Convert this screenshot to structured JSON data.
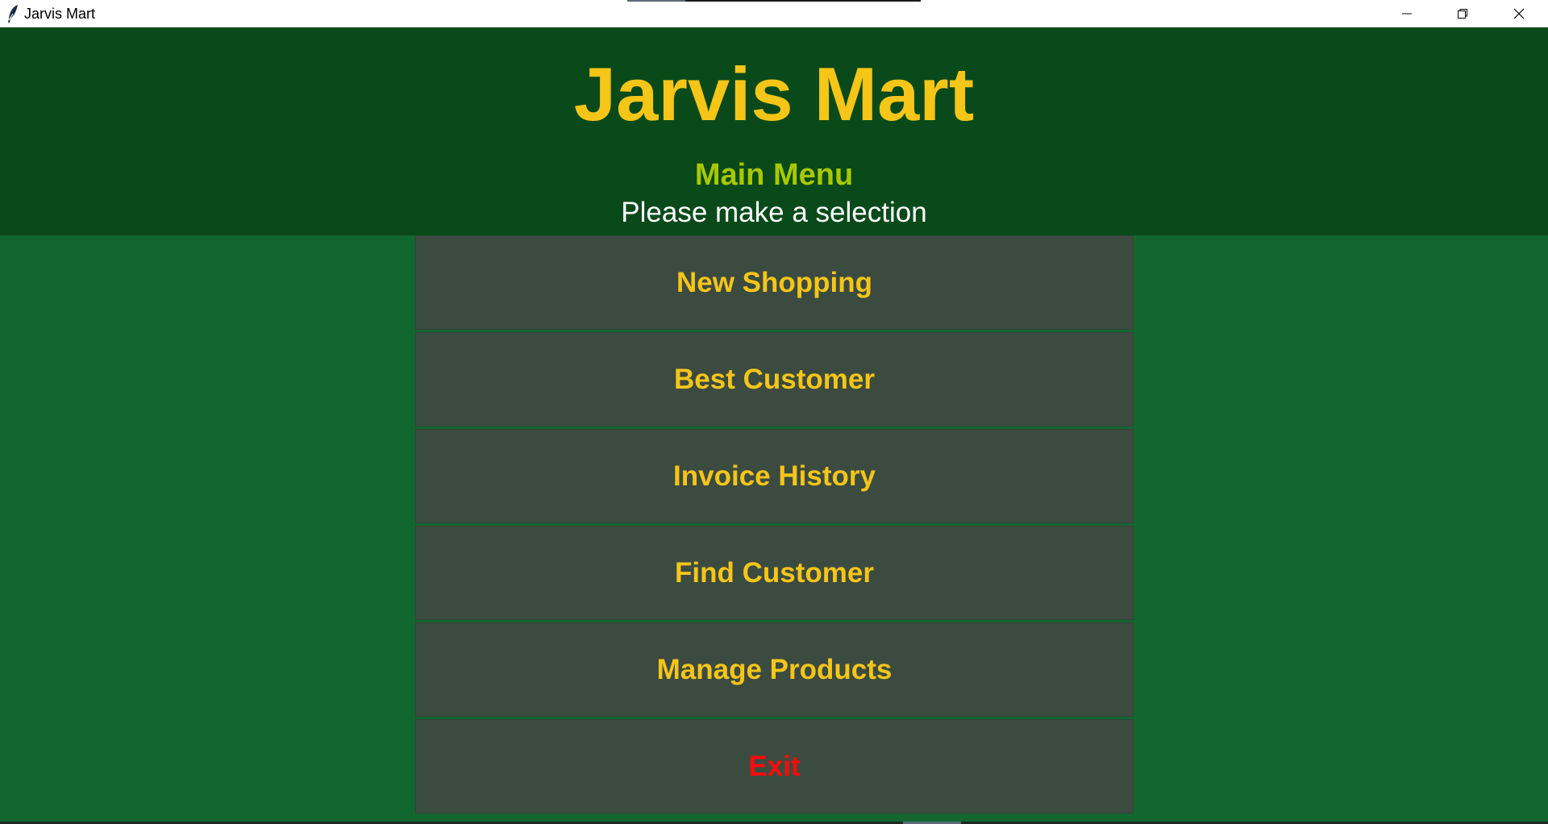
{
  "window": {
    "title": "Jarvis Mart"
  },
  "header": {
    "title": "Jarvis Mart",
    "subtitle": "Main Menu",
    "instruction": "Please make a selection"
  },
  "menu": {
    "items": [
      {
        "label": "New Shopping"
      },
      {
        "label": "Best Customer"
      },
      {
        "label": "Invoice History"
      },
      {
        "label": "Find Customer"
      },
      {
        "label": "Manage Products"
      },
      {
        "label": "Exit"
      }
    ]
  },
  "colors": {
    "header_bg": "#0a4a1a",
    "body_bg": "#126630",
    "title": "#f5c518",
    "subtitle": "#a8c800",
    "button_bg": "#3c4b40",
    "exit": "#ff0a0a"
  },
  "icons": {
    "app": "feather-icon",
    "minimize": "minimize-icon",
    "maximize": "restore-icon",
    "close": "close-icon"
  }
}
